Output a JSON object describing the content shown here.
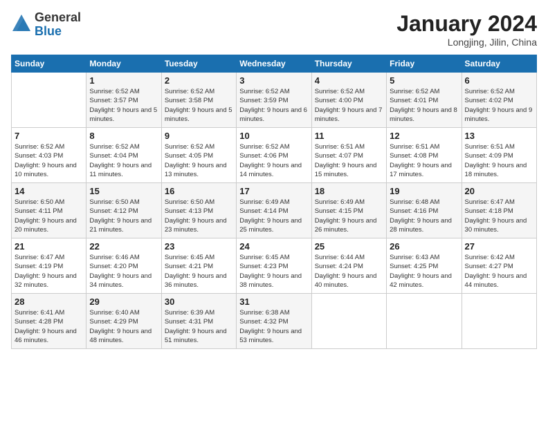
{
  "logo": {
    "general": "General",
    "blue": "Blue"
  },
  "title": "January 2024",
  "location": "Longjing, Jilin, China",
  "days_header": [
    "Sunday",
    "Monday",
    "Tuesday",
    "Wednesday",
    "Thursday",
    "Friday",
    "Saturday"
  ],
  "weeks": [
    [
      {
        "day": "",
        "info": ""
      },
      {
        "day": "1",
        "info": "Sunrise: 6:52 AM\nSunset: 3:57 PM\nDaylight: 9 hours\nand 5 minutes."
      },
      {
        "day": "2",
        "info": "Sunrise: 6:52 AM\nSunset: 3:58 PM\nDaylight: 9 hours\nand 5 minutes."
      },
      {
        "day": "3",
        "info": "Sunrise: 6:52 AM\nSunset: 3:59 PM\nDaylight: 9 hours\nand 6 minutes."
      },
      {
        "day": "4",
        "info": "Sunrise: 6:52 AM\nSunset: 4:00 PM\nDaylight: 9 hours\nand 7 minutes."
      },
      {
        "day": "5",
        "info": "Sunrise: 6:52 AM\nSunset: 4:01 PM\nDaylight: 9 hours\nand 8 minutes."
      },
      {
        "day": "6",
        "info": "Sunrise: 6:52 AM\nSunset: 4:02 PM\nDaylight: 9 hours\nand 9 minutes."
      }
    ],
    [
      {
        "day": "7",
        "info": "Sunrise: 6:52 AM\nSunset: 4:03 PM\nDaylight: 9 hours\nand 10 minutes."
      },
      {
        "day": "8",
        "info": "Sunrise: 6:52 AM\nSunset: 4:04 PM\nDaylight: 9 hours\nand 11 minutes."
      },
      {
        "day": "9",
        "info": "Sunrise: 6:52 AM\nSunset: 4:05 PM\nDaylight: 9 hours\nand 13 minutes."
      },
      {
        "day": "10",
        "info": "Sunrise: 6:52 AM\nSunset: 4:06 PM\nDaylight: 9 hours\nand 14 minutes."
      },
      {
        "day": "11",
        "info": "Sunrise: 6:51 AM\nSunset: 4:07 PM\nDaylight: 9 hours\nand 15 minutes."
      },
      {
        "day": "12",
        "info": "Sunrise: 6:51 AM\nSunset: 4:08 PM\nDaylight: 9 hours\nand 17 minutes."
      },
      {
        "day": "13",
        "info": "Sunrise: 6:51 AM\nSunset: 4:09 PM\nDaylight: 9 hours\nand 18 minutes."
      }
    ],
    [
      {
        "day": "14",
        "info": "Sunrise: 6:50 AM\nSunset: 4:11 PM\nDaylight: 9 hours\nand 20 minutes."
      },
      {
        "day": "15",
        "info": "Sunrise: 6:50 AM\nSunset: 4:12 PM\nDaylight: 9 hours\nand 21 minutes."
      },
      {
        "day": "16",
        "info": "Sunrise: 6:50 AM\nSunset: 4:13 PM\nDaylight: 9 hours\nand 23 minutes."
      },
      {
        "day": "17",
        "info": "Sunrise: 6:49 AM\nSunset: 4:14 PM\nDaylight: 9 hours\nand 25 minutes."
      },
      {
        "day": "18",
        "info": "Sunrise: 6:49 AM\nSunset: 4:15 PM\nDaylight: 9 hours\nand 26 minutes."
      },
      {
        "day": "19",
        "info": "Sunrise: 6:48 AM\nSunset: 4:16 PM\nDaylight: 9 hours\nand 28 minutes."
      },
      {
        "day": "20",
        "info": "Sunrise: 6:47 AM\nSunset: 4:18 PM\nDaylight: 9 hours\nand 30 minutes."
      }
    ],
    [
      {
        "day": "21",
        "info": "Sunrise: 6:47 AM\nSunset: 4:19 PM\nDaylight: 9 hours\nand 32 minutes."
      },
      {
        "day": "22",
        "info": "Sunrise: 6:46 AM\nSunset: 4:20 PM\nDaylight: 9 hours\nand 34 minutes."
      },
      {
        "day": "23",
        "info": "Sunrise: 6:45 AM\nSunset: 4:21 PM\nDaylight: 9 hours\nand 36 minutes."
      },
      {
        "day": "24",
        "info": "Sunrise: 6:45 AM\nSunset: 4:23 PM\nDaylight: 9 hours\nand 38 minutes."
      },
      {
        "day": "25",
        "info": "Sunrise: 6:44 AM\nSunset: 4:24 PM\nDaylight: 9 hours\nand 40 minutes."
      },
      {
        "day": "26",
        "info": "Sunrise: 6:43 AM\nSunset: 4:25 PM\nDaylight: 9 hours\nand 42 minutes."
      },
      {
        "day": "27",
        "info": "Sunrise: 6:42 AM\nSunset: 4:27 PM\nDaylight: 9 hours\nand 44 minutes."
      }
    ],
    [
      {
        "day": "28",
        "info": "Sunrise: 6:41 AM\nSunset: 4:28 PM\nDaylight: 9 hours\nand 46 minutes."
      },
      {
        "day": "29",
        "info": "Sunrise: 6:40 AM\nSunset: 4:29 PM\nDaylight: 9 hours\nand 48 minutes."
      },
      {
        "day": "30",
        "info": "Sunrise: 6:39 AM\nSunset: 4:31 PM\nDaylight: 9 hours\nand 51 minutes."
      },
      {
        "day": "31",
        "info": "Sunrise: 6:38 AM\nSunset: 4:32 PM\nDaylight: 9 hours\nand 53 minutes."
      },
      {
        "day": "",
        "info": ""
      },
      {
        "day": "",
        "info": ""
      },
      {
        "day": "",
        "info": ""
      }
    ]
  ]
}
